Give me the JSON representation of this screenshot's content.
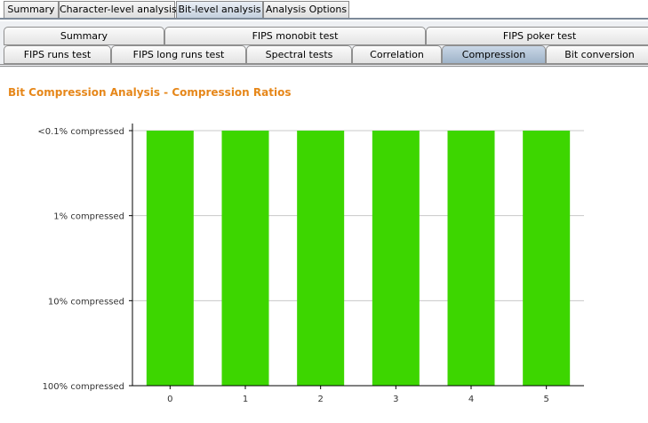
{
  "top_tabs": [
    {
      "label": "Summary",
      "active": false
    },
    {
      "label": "Character-level analysis",
      "active": false
    },
    {
      "label": "Bit-level analysis",
      "active": true
    },
    {
      "label": "Analysis Options",
      "active": false
    }
  ],
  "sub_tabs_row1": [
    {
      "label": "Summary"
    },
    {
      "label": "FIPS monobit test"
    },
    {
      "label": "FIPS poker test"
    }
  ],
  "sub_tabs_row2": [
    {
      "label": "FIPS runs test",
      "active": false
    },
    {
      "label": "FIPS long runs test",
      "active": false
    },
    {
      "label": "Spectral tests",
      "active": false
    },
    {
      "label": "Correlation",
      "active": false
    },
    {
      "label": "Compression",
      "active": true
    },
    {
      "label": "Bit conversion",
      "active": false
    }
  ],
  "panel": {
    "title": "Bit Compression Analysis - Compression Ratios"
  },
  "chart_data": {
    "type": "bar",
    "categories": [
      "0",
      "1",
      "2",
      "3",
      "4",
      "5"
    ],
    "values": [
      "<0.1% compressed",
      "<0.1% compressed",
      "<0.1% compressed",
      "<0.1% compressed",
      "<0.1% compressed",
      "<0.1% compressed"
    ],
    "y_tick_labels": [
      "100% compressed",
      "10% compressed",
      "1% compressed",
      "<0.1% compressed"
    ],
    "bar_color": "#3dd600",
    "grid": true,
    "title": "",
    "xlabel": "",
    "ylabel": ""
  }
}
